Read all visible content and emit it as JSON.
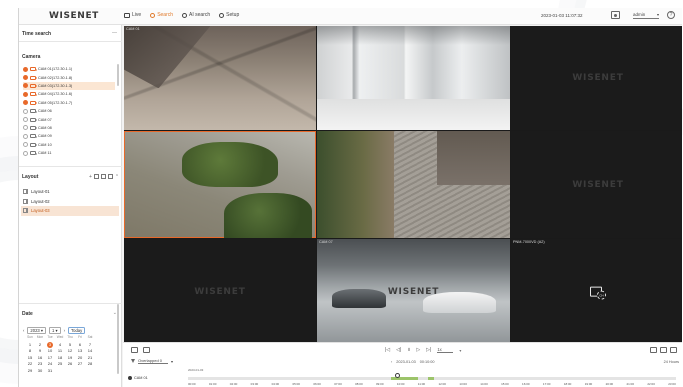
{
  "header": {
    "logo": "WISENET",
    "menu": [
      {
        "label": "Live",
        "icon": "monitor-icon",
        "active": false
      },
      {
        "label": "Search",
        "icon": "search-icon",
        "active": true
      },
      {
        "label": "AI search",
        "icon": "ai-search-icon",
        "active": false
      },
      {
        "label": "Setup",
        "icon": "gear-icon",
        "active": false
      }
    ],
    "datetime": "2023-01-03 11:07:32",
    "user": "admin",
    "help_glyph": "?"
  },
  "sidebar": {
    "time_search_title": "Time search",
    "camera_title": "Camera",
    "cameras": [
      {
        "label": "CAM 01(172.30.1.1)",
        "recording": true,
        "selected": false
      },
      {
        "label": "CAM 02(172.30.1.8)",
        "recording": true,
        "selected": false
      },
      {
        "label": "CAM 03(172.30.1.3)",
        "recording": true,
        "selected": true
      },
      {
        "label": "CAM 04(172.30.1.6)",
        "recording": true,
        "selected": false
      },
      {
        "label": "CAM 05(172.30.1.7)",
        "recording": true,
        "selected": false
      },
      {
        "label": "CAM 06",
        "recording": false,
        "selected": false
      },
      {
        "label": "CAM 07",
        "recording": false,
        "selected": false
      },
      {
        "label": "CAM 08",
        "recording": false,
        "selected": false
      },
      {
        "label": "CAM 09",
        "recording": false,
        "selected": false
      },
      {
        "label": "CAM 10",
        "recording": false,
        "selected": false
      },
      {
        "label": "CAM 11",
        "recording": false,
        "selected": false
      }
    ],
    "layout_title": "Layout",
    "layouts": [
      {
        "label": "Layout-01",
        "selected": false
      },
      {
        "label": "Layout-02",
        "selected": false
      },
      {
        "label": "Layout-03",
        "selected": true
      }
    ],
    "date_title": "Date",
    "calendar": {
      "year": "2023",
      "month": "1",
      "today_label": "Today",
      "weekdays": [
        "Sun",
        "Mon",
        "Tue",
        "Wed",
        "Thu",
        "Fri",
        "Sat"
      ],
      "days": [
        "1",
        "2",
        "3",
        "4",
        "5",
        "6",
        "7",
        "8",
        "9",
        "10",
        "11",
        "12",
        "13",
        "14",
        "15",
        "16",
        "17",
        "18",
        "19",
        "20",
        "21",
        "22",
        "23",
        "24",
        "25",
        "26",
        "27",
        "28",
        "29",
        "30",
        "31"
      ],
      "marked_day": "3"
    }
  },
  "tiles": [
    {
      "label": "CAM 01",
      "type": "video",
      "scene": "floor",
      "watermark": "",
      "selected": false
    },
    {
      "label": "",
      "type": "video",
      "scene": "lobby",
      "watermark": "",
      "selected": false
    },
    {
      "label": "",
      "type": "empty",
      "scene": "",
      "watermark": "WISENET",
      "selected": false
    },
    {
      "label": "",
      "type": "video",
      "scene": "garden",
      "watermark": "",
      "selected": true
    },
    {
      "label": "",
      "type": "video",
      "scene": "stairs",
      "watermark": "",
      "selected": false
    },
    {
      "label": "",
      "type": "empty",
      "scene": "",
      "watermark": "WISENET",
      "selected": false
    },
    {
      "label": "",
      "type": "empty",
      "scene": "",
      "watermark": "WISENET",
      "selected": false
    },
    {
      "label": "CAM 07",
      "type": "video",
      "scene": "parking",
      "watermark": "WISENET",
      "selected": false
    },
    {
      "label": "PNM-7000VD (A2)",
      "type": "nosignal",
      "scene": "",
      "watermark": "",
      "selected": false,
      "badge": "CH"
    }
  ],
  "playback": {
    "speed": "1x",
    "overlap_label": "Overlapped 0",
    "seek_date": "2023-01-03",
    "seek_time": "00:10:00",
    "zoom_label": "24 Hours",
    "timeline_camera": "CAM 01",
    "timeline_date": "2023-01-03",
    "ticks": [
      "00:00",
      "01:00",
      "02:00",
      "03:00",
      "04:00",
      "05:00",
      "06:00",
      "07:00",
      "08:00",
      "09:00",
      "10:00",
      "11:00",
      "12:00",
      "13:00",
      "14:00",
      "15:00",
      "16:00",
      "17:00",
      "18:00",
      "19:00",
      "20:00",
      "21:00",
      "22:00",
      "23:00"
    ],
    "recorded_ranges": [
      [
        10.0,
        11.3
      ],
      [
        11.8,
        12.1
      ]
    ],
    "cursor_hour": 10.3
  },
  "colors": {
    "accent": "#e8692a",
    "recorded": "#9cc46a"
  }
}
